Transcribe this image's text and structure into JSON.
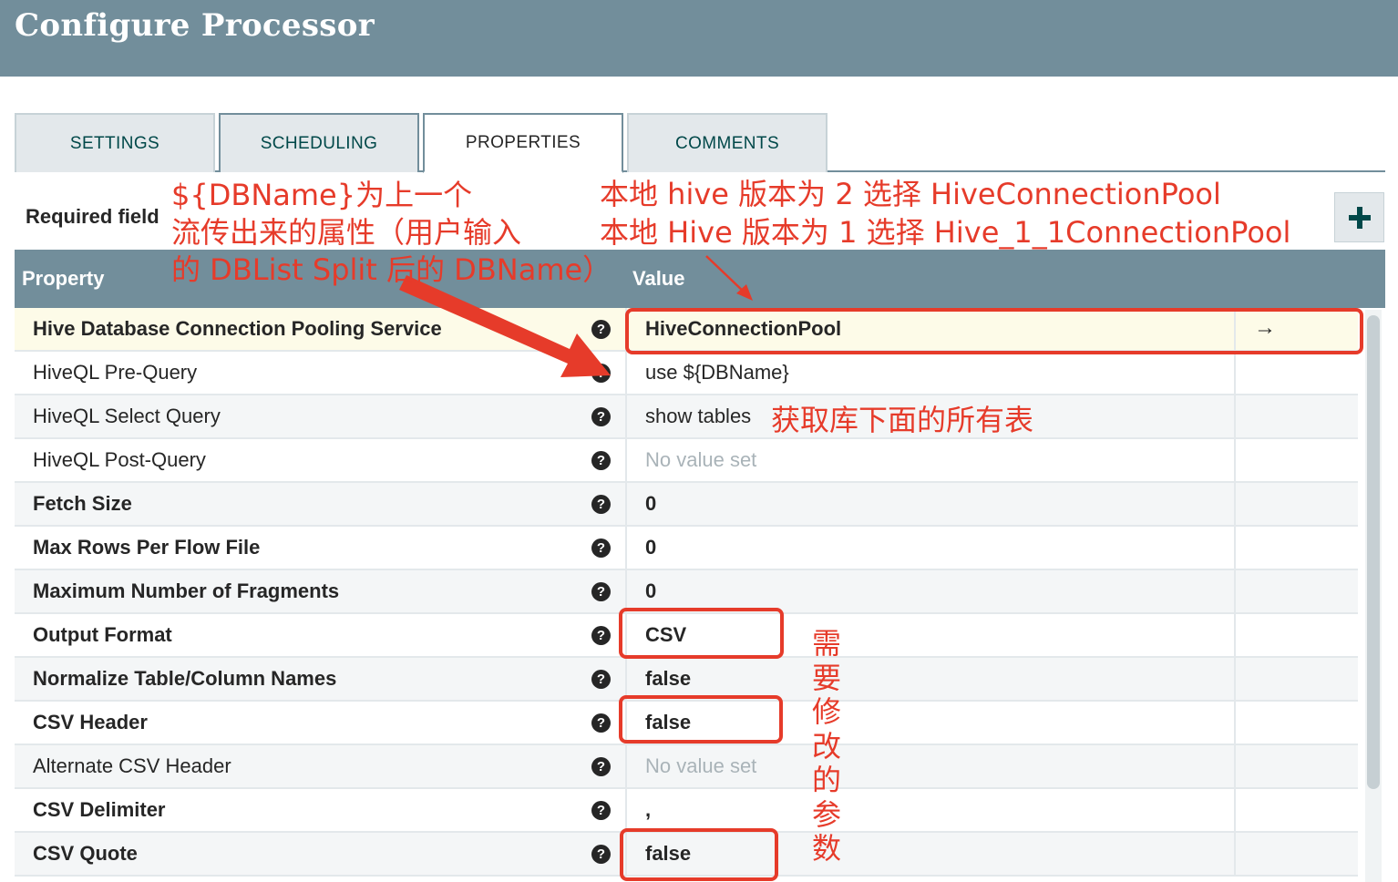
{
  "window": {
    "title": "Configure Processor"
  },
  "tabs": [
    {
      "label": "SETTINGS",
      "active": false
    },
    {
      "label": "SCHEDULING",
      "active": false
    },
    {
      "label": "PROPERTIES",
      "active": true
    },
    {
      "label": "COMMENTS",
      "active": false
    }
  ],
  "required_label": "Required field",
  "table": {
    "headers": {
      "property": "Property",
      "value": "Value"
    },
    "rows": [
      {
        "name": "Hive Database Connection Pooling Service",
        "required": true,
        "value": "HiveConnectionPool",
        "value_set": true,
        "value_bold": true
      },
      {
        "name": "HiveQL Pre-Query",
        "required": false,
        "value": "use ${DBName}",
        "value_set": true,
        "value_bold": false
      },
      {
        "name": "HiveQL Select Query",
        "required": false,
        "value": "show tables",
        "value_set": true,
        "value_bold": false
      },
      {
        "name": "HiveQL Post-Query",
        "required": false,
        "value": "No value set",
        "value_set": false,
        "value_bold": false
      },
      {
        "name": "Fetch Size",
        "required": true,
        "value": "0",
        "value_set": true,
        "value_bold": true
      },
      {
        "name": "Max Rows Per Flow File",
        "required": true,
        "value": "0",
        "value_set": true,
        "value_bold": true
      },
      {
        "name": "Maximum Number of Fragments",
        "required": true,
        "value": "0",
        "value_set": true,
        "value_bold": true
      },
      {
        "name": "Output Format",
        "required": true,
        "value": "CSV",
        "value_set": true,
        "value_bold": true
      },
      {
        "name": "Normalize Table/Column Names",
        "required": true,
        "value": "false",
        "value_set": true,
        "value_bold": true
      },
      {
        "name": "CSV Header",
        "required": true,
        "value": "false",
        "value_set": true,
        "value_bold": true
      },
      {
        "name": "Alternate CSV Header",
        "required": false,
        "value": "No value set",
        "value_set": false,
        "value_bold": false
      },
      {
        "name": "CSV Delimiter",
        "required": true,
        "value": ",",
        "value_set": true,
        "value_bold": true
      },
      {
        "name": "CSV Quote",
        "required": true,
        "value": "false",
        "value_set": true,
        "value_bold": true
      }
    ]
  },
  "annotations": {
    "left_lines": [
      "${DBName}为上一个",
      "流传出来的属性（用户输入",
      "的 DBList Split 后的 DBName）"
    ],
    "right_lines": [
      "本地 hive 版本为 2 选择 HiveConnectionPool",
      "本地 Hive 版本为 1 选择 Hive_1_1ConnectionPool"
    ],
    "tables_note": "获取库下面的所有表",
    "vertical_note": "需要修改的参数"
  },
  "icons": {
    "help": "question-circle-icon",
    "add": "plus-icon",
    "goto": "arrow-right-icon"
  },
  "colors": {
    "header_bg": "#728e9b",
    "annotation": "#e63b2a",
    "selected_row": "#fdfbe8"
  }
}
